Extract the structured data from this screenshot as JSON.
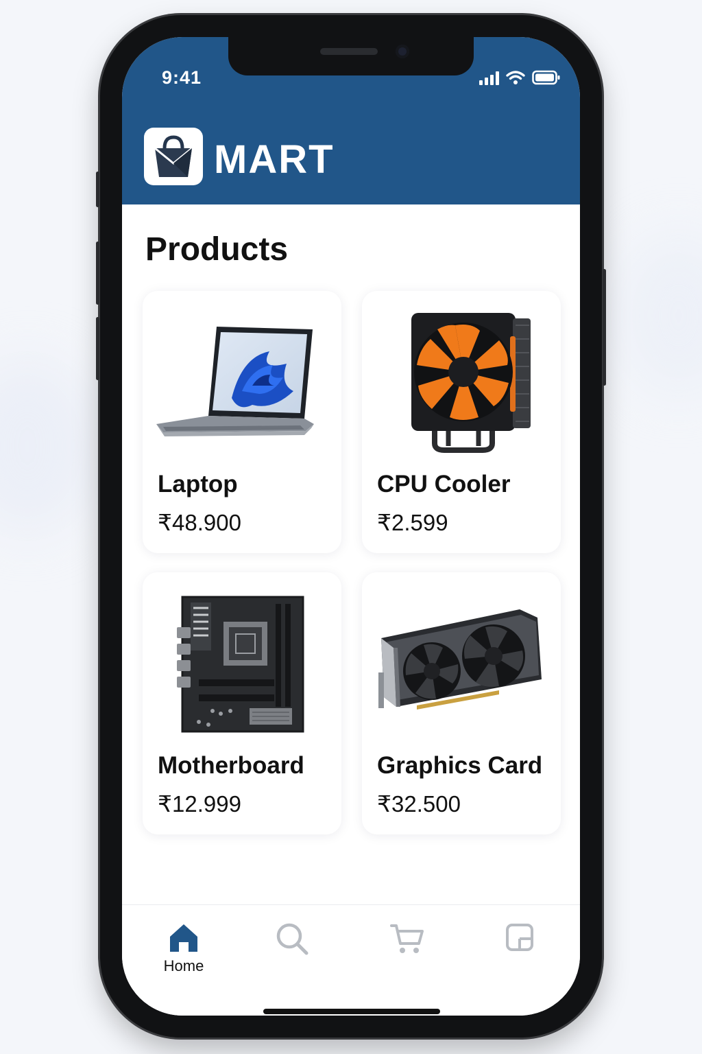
{
  "status_bar": {
    "time": "9:41",
    "icons": [
      "signal-icon",
      "wifi-icon",
      "battery-icon"
    ]
  },
  "header": {
    "logo_icon": "shopping-bag-icon",
    "brand": "MART",
    "color": "#215689"
  },
  "section": {
    "title": "Products"
  },
  "products": [
    {
      "name": "Laptop",
      "price": "₹48.900",
      "image": "laptop-image"
    },
    {
      "name": "CPU Cooler",
      "price": "₹2.599",
      "image": "cpu-cooler-image"
    },
    {
      "name": "Motherboard",
      "price": "₹12.999",
      "image": "motherboard-image"
    },
    {
      "name": "Graphics Card",
      "price": "₹32.500",
      "image": "graphics-card-image"
    }
  ],
  "tabbar": {
    "tabs": [
      {
        "icon": "home-icon",
        "label": "Home",
        "active": true
      },
      {
        "icon": "search-icon",
        "active": false
      },
      {
        "icon": "cart-icon",
        "active": false
      },
      {
        "icon": "profile-icon",
        "active": false
      }
    ],
    "active_color": "#215689",
    "inactive_color": "#b8bcc2"
  },
  "accent_color": "#f07a1a"
}
